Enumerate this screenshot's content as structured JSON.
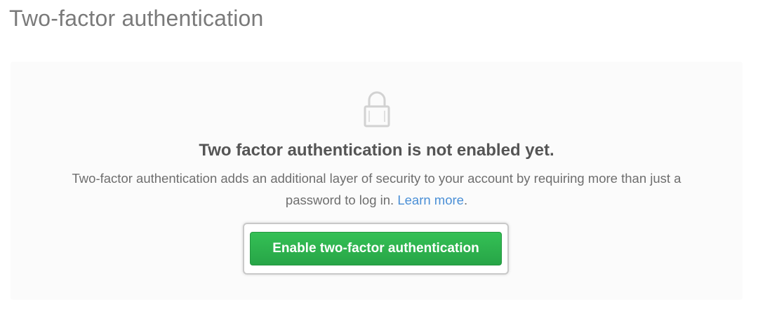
{
  "page": {
    "title": "Two-factor authentication"
  },
  "blankslate": {
    "icon": "lock-icon",
    "heading": "Two factor authentication is not enabled yet.",
    "description": "Two-factor authentication adds an additional layer of security to your account by requiring more than just a password to log in.",
    "learn_more_label": "Learn more",
    "period": "."
  },
  "actions": {
    "enable_label": "Enable two-factor authentication"
  },
  "colors": {
    "primary_button": "#2ea44f",
    "link": "#4a8fd6",
    "title": "#7a7a7a"
  }
}
